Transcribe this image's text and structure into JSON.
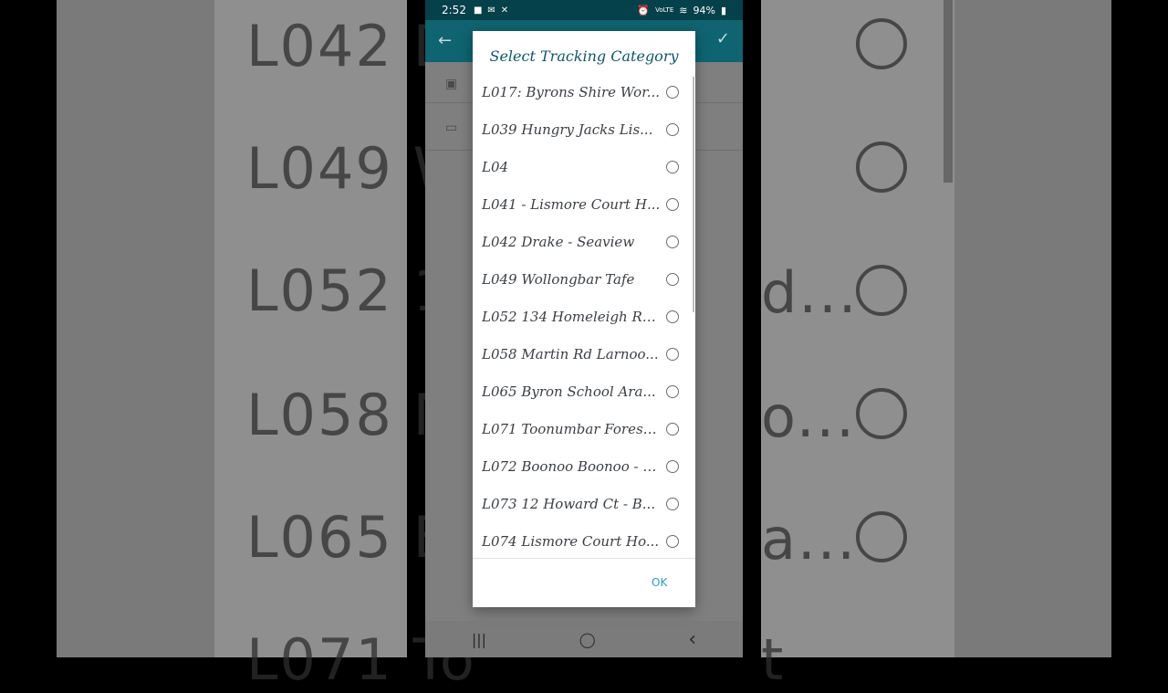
{
  "status_bar": {
    "time": "2:52",
    "left_icons": [
      "video-icon",
      "message-icon",
      "missed-call-icon"
    ],
    "network": "VoLTE",
    "battery": "94%"
  },
  "app_bar": {
    "back_icon": "arrow-left-icon",
    "confirm_icon": "check-icon"
  },
  "dialog": {
    "title": "Select Tracking Category",
    "options": [
      {
        "label": "L017: Byrons Shire Wor..."
      },
      {
        "label": "L039 Hungry Jacks Lis..."
      },
      {
        "label": "L04"
      },
      {
        "label": "L041 - Lismore Court H..."
      },
      {
        "label": "L042 Drake - Seaview"
      },
      {
        "label": "L049 Wollongbar Tafe"
      },
      {
        "label": "L052 134 Homeleigh Rd..."
      },
      {
        "label": "L058 Martin Rd Larnoo..."
      },
      {
        "label": "L065 Byron School Ara..."
      },
      {
        "label": "L071 Toonumbar Forest..."
      },
      {
        "label": "L072 Boonoo Boonoo - P..."
      },
      {
        "label": "L073 12 Howard Ct - B..."
      },
      {
        "label": "L074 Lismore Court Ho..."
      }
    ],
    "ok_label": "OK"
  },
  "nav_bar": {
    "recent": "|||",
    "home": "◯",
    "back": "‹"
  },
  "background": {
    "left_texts": [
      "L042 D",
      "L049 W",
      "L052 13",
      "L058 M",
      "L065 B",
      "L071 To"
    ],
    "right_texts": [
      "d...",
      "o...",
      "a...",
      "t"
    ]
  },
  "colors": {
    "status_bar": "#05414a",
    "app_bar": "#0e6470",
    "dialog_title": "#0e5866",
    "ok_button": "#2a9fbd"
  }
}
